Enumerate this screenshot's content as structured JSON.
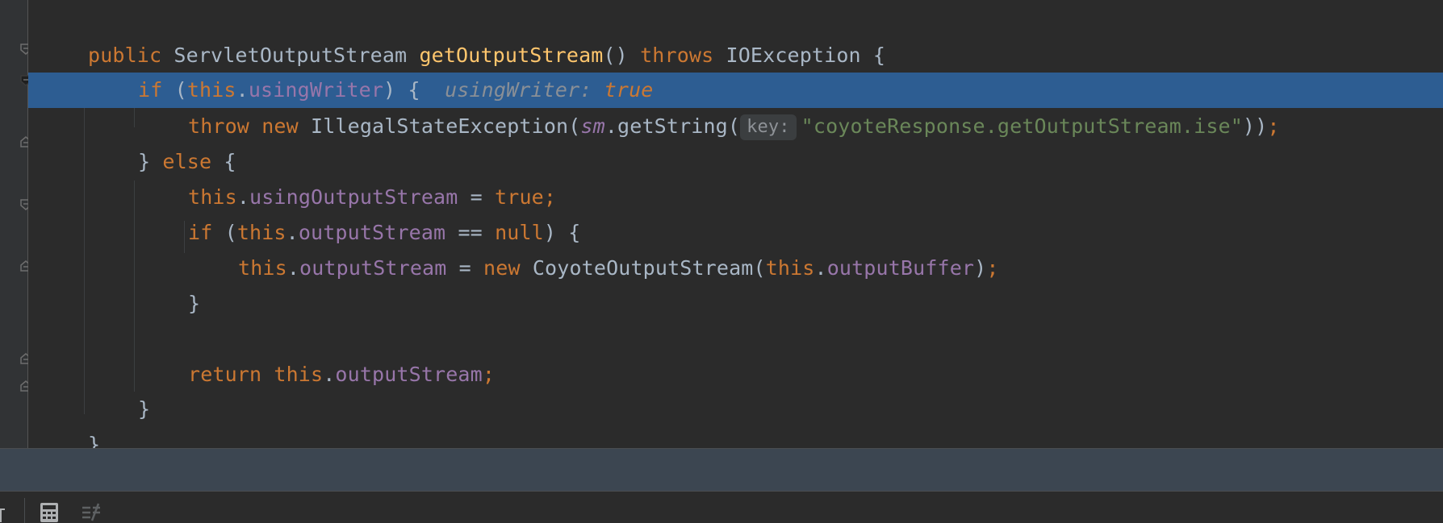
{
  "editor": {
    "lines": [
      {
        "parts": [
          [
            "kw",
            "public "
          ],
          [
            "plain",
            "ServletOutputStream "
          ],
          [
            "fn",
            "getOutputStream"
          ],
          [
            "plain",
            "() "
          ],
          [
            "kw",
            "throws "
          ],
          [
            "plain",
            "IOException {"
          ]
        ]
      },
      {
        "parts": [
          [
            "kw",
            "if "
          ],
          [
            "plain",
            "("
          ],
          [
            "kw",
            "this"
          ],
          [
            "plain",
            "."
          ],
          [
            "fld",
            "usingWriter"
          ],
          [
            "plain",
            ") {"
          ]
        ],
        "inline_hint": {
          "name": "usingWriter:",
          "value": "true"
        }
      },
      {
        "parts": [
          [
            "kw",
            "throw new "
          ],
          [
            "plain",
            "IllegalStateException("
          ],
          [
            "fld ital",
            "sm"
          ],
          [
            "plain",
            ".getString("
          ],
          [
            "hint",
            "key:"
          ],
          [
            "str",
            "\"coyoteResponse.getOutputStream.ise\""
          ],
          [
            "plain",
            "))"
          ],
          [
            "kw",
            ";"
          ]
        ]
      },
      {
        "parts": [
          [
            "plain",
            "} "
          ],
          [
            "kw",
            "else "
          ],
          [
            "plain",
            "{"
          ]
        ]
      },
      {
        "parts": [
          [
            "kw",
            "this"
          ],
          [
            "plain",
            "."
          ],
          [
            "fld",
            "usingOutputStream"
          ],
          [
            "plain",
            " = "
          ],
          [
            "kw",
            "true;"
          ]
        ]
      },
      {
        "parts": [
          [
            "kw",
            "if "
          ],
          [
            "plain",
            "("
          ],
          [
            "kw",
            "this"
          ],
          [
            "plain",
            "."
          ],
          [
            "fld",
            "outputStream"
          ],
          [
            "plain",
            " == "
          ],
          [
            "kw",
            "null"
          ],
          [
            "plain",
            ") {"
          ]
        ]
      },
      {
        "parts": [
          [
            "kw",
            "this"
          ],
          [
            "plain",
            "."
          ],
          [
            "fld",
            "outputStream"
          ],
          [
            "plain",
            " = "
          ],
          [
            "kw",
            "new "
          ],
          [
            "plain",
            "CoyoteOutputStream("
          ],
          [
            "kw",
            "this"
          ],
          [
            "plain",
            "."
          ],
          [
            "fld",
            "outputBuffer"
          ],
          [
            "plain",
            ")"
          ],
          [
            "kw",
            ";"
          ]
        ]
      },
      {
        "parts": [
          [
            "plain",
            "}"
          ]
        ]
      },
      {
        "parts": []
      },
      {
        "parts": [
          [
            "kw",
            "return this"
          ],
          [
            "plain",
            "."
          ],
          [
            "fld",
            "outputStream"
          ],
          [
            "kw",
            ";"
          ]
        ]
      },
      {
        "parts": [
          [
            "plain",
            "}"
          ]
        ]
      },
      {
        "parts": [
          [
            "plain",
            "}"
          ]
        ]
      }
    ]
  },
  "toolbar": {
    "icons": [
      "calculator-icon",
      "evaluate-expression-icon"
    ]
  }
}
